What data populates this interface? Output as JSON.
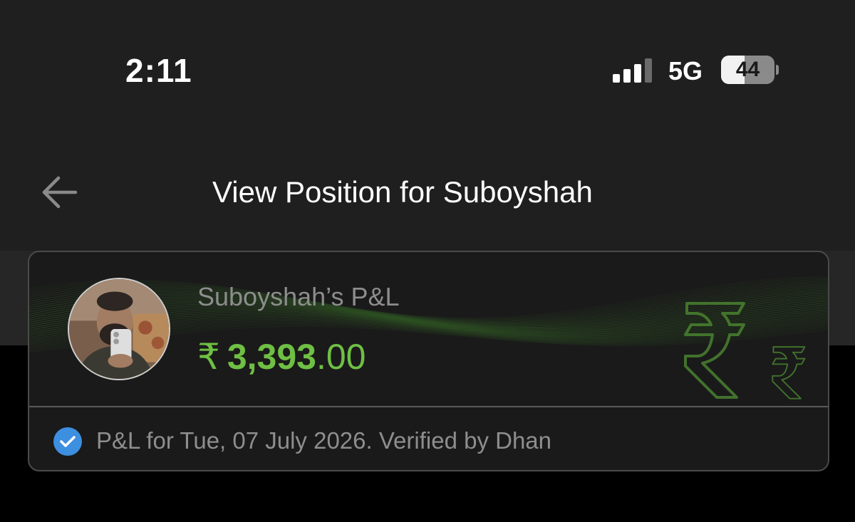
{
  "status_bar": {
    "time": "2:11",
    "network": "5G",
    "battery_percent": "44",
    "battery_level": 0.44
  },
  "nav": {
    "title": "View Position for Suboyshah",
    "back_icon": "arrow-left-icon"
  },
  "pnl_card": {
    "name_label": "Suboyshah’s P&L",
    "currency_symbol": "₹",
    "amount_integer": "3,393",
    "amount_decimal": ".00",
    "verification_text": "P&L for Tue, 07 July 2026. Verified by Dhan",
    "verified_icon": "check-circle-icon",
    "decor_icon": "rupee-icon"
  },
  "colors": {
    "accent_green": "#6fbf44",
    "verified_blue": "#3d8fe0",
    "background": "#000000",
    "header": "#1f1f1f"
  }
}
